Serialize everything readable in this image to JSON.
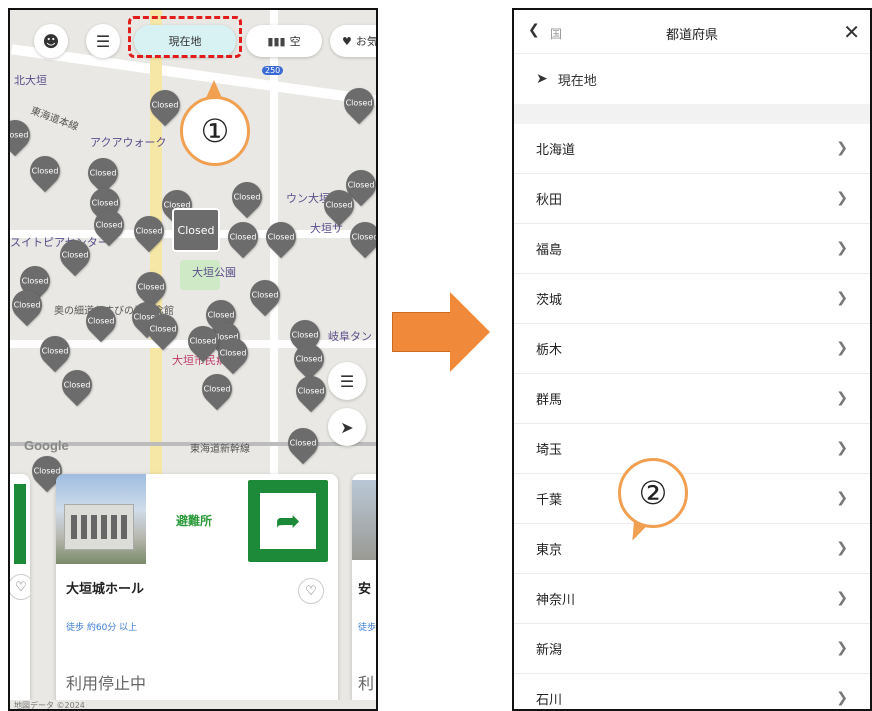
{
  "left_screen": {
    "top_bar": {
      "current_location_label": "現在地",
      "vacancy_label": "空",
      "favorites_label": "お気"
    },
    "callout_1": "①",
    "map": {
      "labels": [
        "北大垣",
        "東海道本線",
        "アクアウォーク",
        "大垣公園",
        "奥の細道むすびの地記念館",
        "大垣市民病院",
        "岐阜タン",
        "東海道新幹線",
        "スイトピアセンター",
        "ウン大垣",
        "大垣サ",
        "250"
      ],
      "google_label": "Google",
      "pin_label": "Closed",
      "pin_count": 38
    },
    "card": {
      "category": "避難所",
      "title": "大垣城ホール",
      "walk_time": "徒歩 約60分 以上",
      "status": "利用停止中",
      "right_partial_title": "安",
      "right_partial_walk": "徒歩",
      "right_partial_status": "利"
    },
    "bottom_strip": "地図データ ©2024"
  },
  "right_screen": {
    "header": {
      "back_label": "国",
      "title": "都道府県"
    },
    "current_location_label": "現在地",
    "prefectures": [
      "北海道",
      "秋田",
      "福島",
      "茨城",
      "栃木",
      "群馬",
      "埼玉",
      "千葉",
      "東京",
      "神奈川",
      "新潟",
      "石川"
    ],
    "callout_2": "②"
  },
  "colors": {
    "accent_orange": "#f08a3a",
    "dash_red": "#e21b1b",
    "evac_green": "#1d8a3a",
    "pin_gray": "#6c6c6c"
  }
}
